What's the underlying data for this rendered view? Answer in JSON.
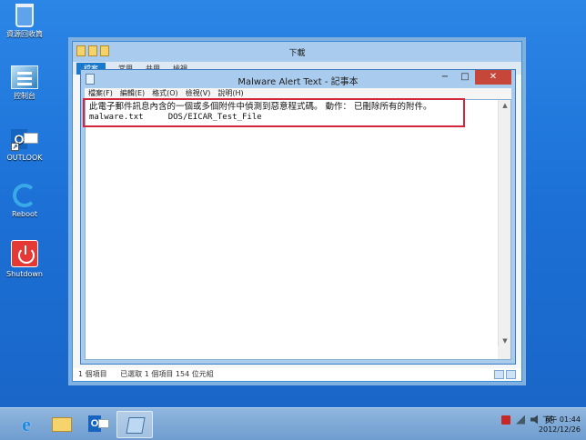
{
  "desktop": {
    "icons": [
      {
        "label": "資源回收筒"
      },
      {
        "label": "控制台"
      },
      {
        "label": "OUTLOOK"
      },
      {
        "label": "Reboot"
      },
      {
        "label": "Shutdown"
      }
    ]
  },
  "explorer": {
    "title": "下載",
    "ribbon_tabs": [
      "檔案",
      "常用",
      "共用",
      "檢視"
    ],
    "status": {
      "items_count": "1 個項目",
      "selected": "已選取 1 個項目 154 位元組"
    }
  },
  "notepad": {
    "title": "Malware Alert Text - 記事本",
    "menu": [
      "檔案(F)",
      "編輯(E)",
      "格式(O)",
      "檢視(V)",
      "說明(H)"
    ],
    "controls": {
      "minimize": "−",
      "maximize": "□",
      "close": "✕"
    },
    "content": {
      "line1": "此電子郵件訊息內含的一個或多個附件中偵測到惡意程式碼。 動作： 已刪除所有的附件。",
      "line2_file": "malware.txt",
      "line2_threat": "DOS/EICAR_Test_File"
    }
  },
  "taskbar": {
    "tray": {
      "ime": "英"
    },
    "clock": {
      "time": "下午 01:44",
      "date": "2012/12/26"
    }
  },
  "colors": {
    "highlight_border": "#d3263b",
    "desktop": "#1c70d6",
    "taskbar": "#7ea9d6"
  }
}
